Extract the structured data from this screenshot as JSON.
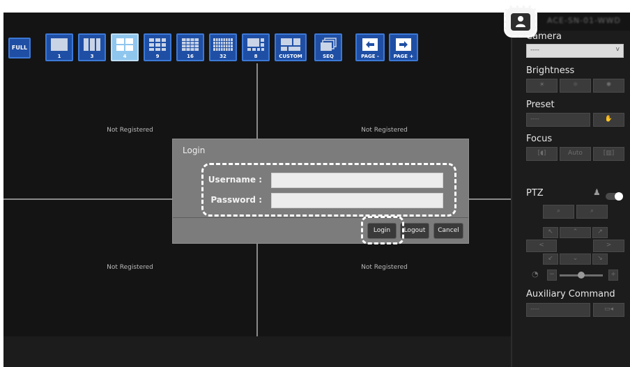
{
  "header": {
    "device_name": "ACE-SN-01-WWD"
  },
  "toolbar": {
    "full_label": "FULL",
    "layouts": [
      {
        "label": "1"
      },
      {
        "label": "3"
      },
      {
        "label": "4",
        "active": true
      },
      {
        "label": "9"
      },
      {
        "label": "16"
      },
      {
        "label": "32"
      },
      {
        "label": "8"
      },
      {
        "label": "CUSTOM"
      }
    ],
    "seq_label": "SEQ",
    "page_prev_label": "PAGE -",
    "page_next_label": "PAGE +"
  },
  "grid": {
    "cells": [
      {
        "status": "Not Registered"
      },
      {
        "status": "Not Registered"
      },
      {
        "status": "Not Registered"
      },
      {
        "status": "Not Registered"
      }
    ]
  },
  "panel": {
    "camera": {
      "title": "Camera",
      "selected": "----"
    },
    "brightness": {
      "title": "Brightness"
    },
    "preset": {
      "title": "Preset",
      "selected": "----"
    },
    "focus": {
      "title": "Focus",
      "auto_label": "Auto"
    },
    "ptz": {
      "title": "PTZ",
      "speed_level": 0.5
    },
    "auxiliary": {
      "title": "Auxiliary Command",
      "selected": "----"
    }
  },
  "dialog": {
    "title": "Login",
    "username_label": "Username :",
    "password_label": "Password :",
    "username_value": "",
    "password_value": "",
    "login_label": "Login",
    "logout_label": "Logout",
    "cancel_label": "Cancel"
  },
  "colors": {
    "accent": "#1f4fa5",
    "active_layout": "#8fc6ee",
    "background": "#141414",
    "dialog": "#7c7c7c"
  }
}
